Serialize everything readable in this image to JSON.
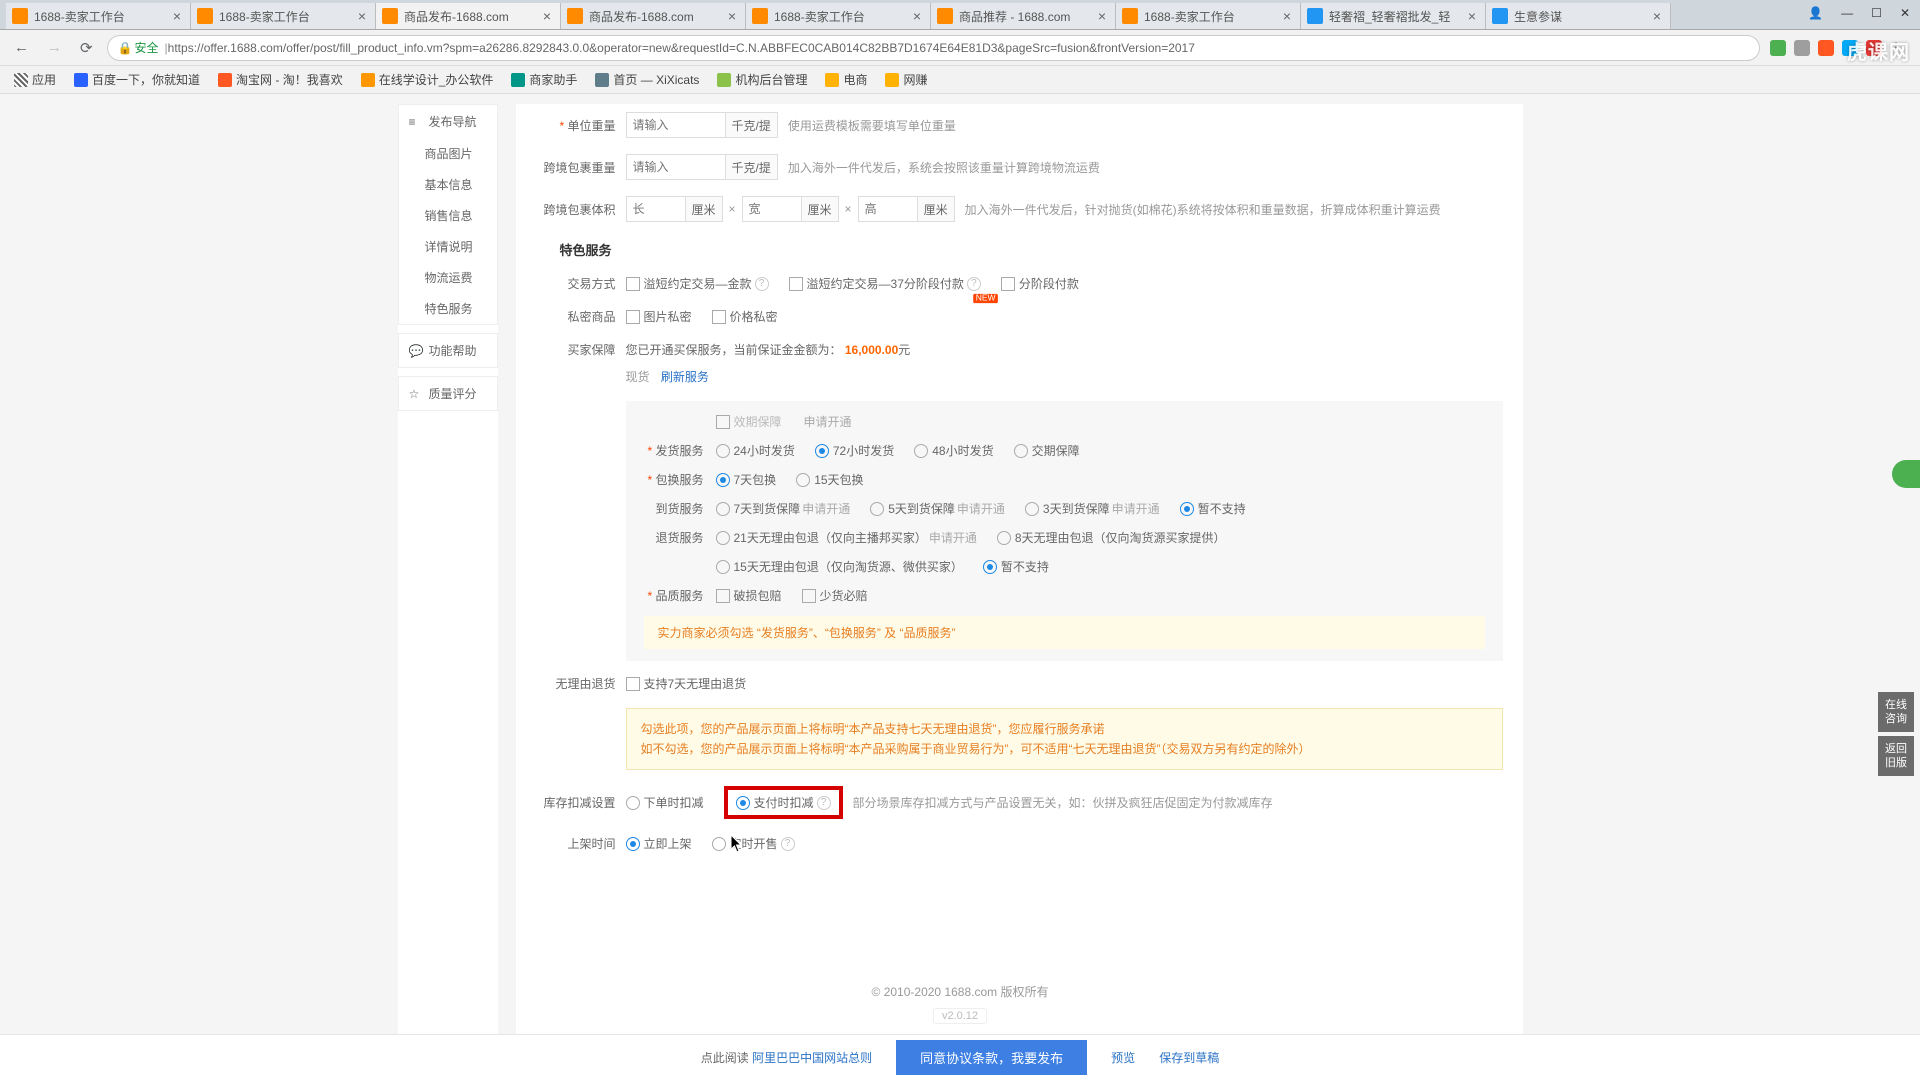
{
  "browser": {
    "tabs": [
      {
        "favicon": "#ff8a00",
        "label": "1688-卖家工作台"
      },
      {
        "favicon": "#ff8a00",
        "label": "1688-卖家工作台"
      },
      {
        "favicon": "#ff8a00",
        "label": "商品发布-1688.com",
        "active": true
      },
      {
        "favicon": "#ff8a00",
        "label": "商品发布-1688.com"
      },
      {
        "favicon": "#ff8a00",
        "label": "1688-卖家工作台"
      },
      {
        "favicon": "#ff8a00",
        "label": "商品推荐 - 1688.com"
      },
      {
        "favicon": "#ff8a00",
        "label": "1688-卖家工作台"
      },
      {
        "favicon": "#2196f3",
        "label": "轻奢褶_轻奢褶批发_轻"
      },
      {
        "favicon": "#2196f3",
        "label": "生意参谋"
      }
    ],
    "secure_label": "安全",
    "url": "https://offer.1688.com/offer/post/fill_product_info.vm?spm=a26286.8292843.0.0&operator=new&requestId=C.N.ABBFEC0CAB014C82BB7D1674E64E81D3&pageSrc=fusion&frontVersion=2017",
    "bookmarks": [
      {
        "icon": "#5a5a5a",
        "label": "应用"
      },
      {
        "icon": "#2962ff",
        "label": "百度一下，你就知道"
      },
      {
        "icon": "#ff5722",
        "label": "淘宝网 - 淘！我喜欢"
      },
      {
        "icon": "#ff9800",
        "label": "在线学设计_办公软件"
      },
      {
        "icon": "#009688",
        "label": "商家助手"
      },
      {
        "icon": "#607d8b",
        "label": "首页 — XiXicats"
      },
      {
        "icon": "#8bc34a",
        "label": "机构后台管理"
      },
      {
        "icon": "#ffb300",
        "label": "电商"
      },
      {
        "icon": "#ffb300",
        "label": "网赚"
      }
    ]
  },
  "sidebar": {
    "nav_title": "发布导航",
    "nav_items": [
      "商品图片",
      "基本信息",
      "销售信息",
      "详情说明",
      "物流运费",
      "特色服务"
    ],
    "help_title": "功能帮助",
    "rating_title": "质量评分"
  },
  "form": {
    "unit_weight": {
      "label": "单位重量",
      "placeholder": "请输入",
      "unit": "千克/提",
      "hint": "使用运费模板需要填写单位重量"
    },
    "cross_weight": {
      "label": "跨境包裹重量",
      "placeholder": "请输入",
      "unit": "千克/提",
      "hint": "加入海外一件代发后，系统会按照该重量计算跨境物流运费"
    },
    "cross_volume": {
      "label": "跨境包裹体积",
      "ph_l": "长",
      "ph_w": "宽",
      "ph_h": "高",
      "unit": "厘米",
      "hint": "加入海外一件代发后，针对抛货(如棉花)系统将按体积和重量数据，折算成体积重计算运费"
    },
    "section_special": "特色服务",
    "trade": {
      "label": "交易方式",
      "opt1": "溢短约定交易—金款",
      "opt2": "溢短约定交易—37分阶段付款",
      "opt3": "分阶段付款",
      "new": "NEW"
    },
    "private": {
      "label": "私密商品",
      "opt1": "图片私密",
      "opt2": "价格私密"
    },
    "guarantee": {
      "label": "买家保障",
      "text_pre": "您已开通买保服务，当前保证金金额为：",
      "amount": "16,000.00",
      "unit": "元",
      "status": "现货",
      "refresh": "刷新服务"
    },
    "gray": {
      "deadline": {
        "label": "效期保障",
        "apply": "申请开通"
      },
      "ship": {
        "label": "发货服务",
        "o1": "24小时发货",
        "o2": "72小时发货",
        "o3": "48小时发货",
        "o4": "交期保障"
      },
      "exchange": {
        "label": "包换服务",
        "o1": "7天包换",
        "o2": "15天包换"
      },
      "arrive": {
        "label": "到货服务",
        "o1": "7天到货保障",
        "o2": "5天到货保障",
        "o3": "3天到货保障",
        "o4": "暂不支持",
        "apply": "申请开通"
      },
      "return": {
        "label": "退货服务",
        "o1": "21天无理由包退（仅向主播邦买家）",
        "o2": "8天无理由包退（仅向淘货源买家提供）",
        "o3": "15天无理由包退（仅向淘货源、微供买家）",
        "o4": "暂不支持",
        "apply": "申请开通"
      },
      "quality": {
        "label": "品质服务",
        "o1": "破损包赔",
        "o2": "少货必赔"
      },
      "mustsel": "实力商家必须勾选 “发货服务”、“包换服务” 及 “品质服务”"
    },
    "noreasonreturn": {
      "label": "无理由退货",
      "opt": "支持7天无理由退货",
      "note1": "勾选此项，您的产品展示页面上将标明“本产品支持七天无理由退货”，您应履行服务承诺",
      "note2": "如不勾选，您的产品展示页面上将标明“本产品采购属于商业贸易行为”，可不适用“七天无理由退货”（交易双方另有约定的除外）"
    },
    "stock": {
      "label": "库存扣减设置",
      "o1": "下单时扣减",
      "o2": "支付时扣减",
      "hint": "部分场景库存扣减方式与产品设置无关，如：伙拼及疯狂店促固定为付款减库存"
    },
    "onshelf": {
      "label": "上架时间",
      "o1": "立即上架",
      "o2": "定时开售"
    }
  },
  "footer": {
    "read": "点此阅读",
    "terms": "阿里巴巴中国网站总则",
    "submit": "同意协议条款，我要发布",
    "preview": "预览",
    "draft": "保存到草稿",
    "version": "v2.0.12",
    "copyright": "© 2010-2020 1688.com 版权所有"
  },
  "float": {
    "a": "在线咨询",
    "b": "返回旧版"
  },
  "watermark": "虎课网"
}
